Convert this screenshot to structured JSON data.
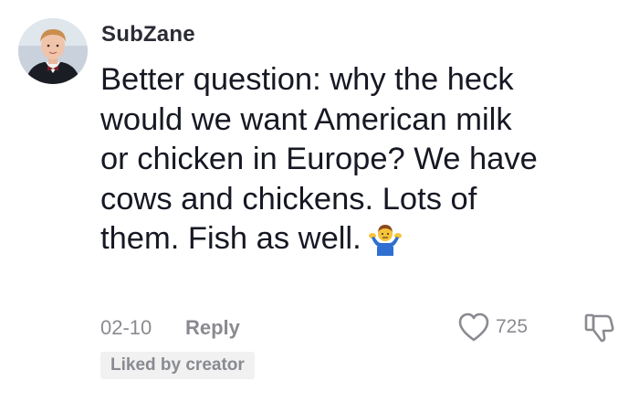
{
  "comment": {
    "author": "SubZane",
    "text_lines": [
      "Better question: why the heck",
      "would we want American milk",
      "or chicken in Europe? We have",
      "cows and chickens. Lots of",
      "them. Fish as well."
    ],
    "emoji": "person-shrugging-icon",
    "date": "02-10",
    "reply_label": "Reply",
    "like_count": "725",
    "creator_badge": "Liked by creator"
  },
  "colors": {
    "text_primary": "#161823",
    "text_secondary": "#8a8b91",
    "badge_bg": "#f1f1f2"
  }
}
